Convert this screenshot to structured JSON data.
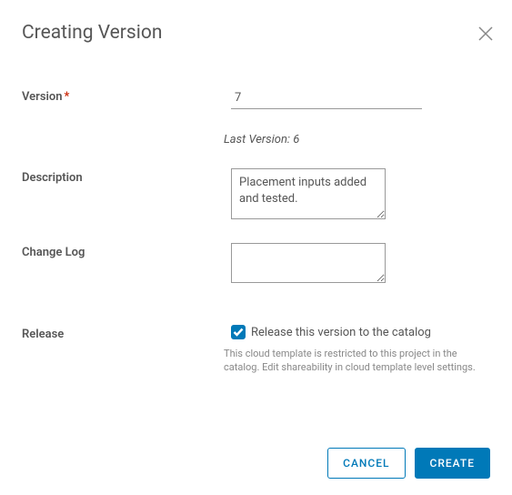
{
  "dialog": {
    "title": "Creating Version"
  },
  "form": {
    "version": {
      "label": "Version",
      "value": "7",
      "last_version_text": "Last Version: 6"
    },
    "description": {
      "label": "Description",
      "value": "Placement inputs added and tested."
    },
    "changelog": {
      "label": "Change Log",
      "value": ""
    },
    "release": {
      "label": "Release",
      "checkbox_label": "Release this version to the catalog",
      "checked": true,
      "restriction_text": "This cloud template is restricted to this project in the catalog. Edit shareability in cloud template level settings."
    }
  },
  "actions": {
    "cancel": "CANCEL",
    "create": "CREATE"
  }
}
